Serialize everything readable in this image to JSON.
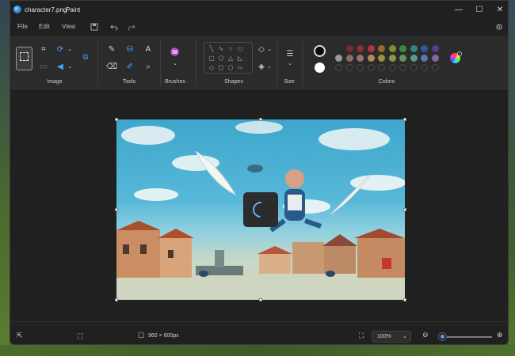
{
  "titlebar": {
    "file_name": "character7.png",
    "app_name": "Paint",
    "minimize": "—",
    "maximize": "☐",
    "close": "✕"
  },
  "menu": {
    "items": [
      "File",
      "Edit",
      "View"
    ],
    "save_icon": "save-icon",
    "undo_icon": "undo-icon",
    "redo_icon": "redo-icon",
    "settings_icon": "gear-icon"
  },
  "ribbon": {
    "groups": {
      "image": "Image",
      "tools": "Tools",
      "brushes": "Brushes",
      "shapes": "Shapes",
      "size": "Size",
      "colors": "Colors"
    },
    "primary_color": "#0a0a0a",
    "secondary_color": "#ffffff",
    "palette_row1": [
      "#2c2c2c",
      "#7a2a2a",
      "#8a3030",
      "#a83838",
      "#9a6a2a",
      "#8a8a2a",
      "#3a8a3a",
      "#2a8a7a",
      "#2a5a9a",
      "#5a3a8a"
    ],
    "palette_row2": [
      "#9a9a9a",
      "#8a6a6a",
      "#a07070",
      "#b08a5a",
      "#a09040",
      "#8a9a40",
      "#5a9a5a",
      "#5a9a8a",
      "#5a7aaa",
      "#7a6aa0"
    ]
  },
  "canvas": {
    "image_description": "painting"
  },
  "status": {
    "dimensions": "960 × 600px",
    "zoom": "100%",
    "zoom_level": 0.08
  }
}
